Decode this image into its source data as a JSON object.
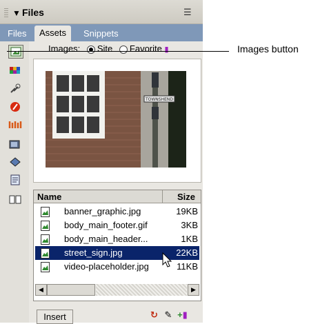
{
  "panel": {
    "title": "Files",
    "tabs": [
      {
        "label": "Files",
        "active": false
      },
      {
        "label": "Assets",
        "active": true
      },
      {
        "label": "Snippets",
        "active": false
      }
    ],
    "images_label": "Images:",
    "radio_site": "Site",
    "radio_favorites": "Favorite",
    "list": {
      "col_name": "Name",
      "col_size": "Size",
      "rows": [
        {
          "name": "banner_graphic.jpg",
          "size": "19KB",
          "selected": false
        },
        {
          "name": "body_main_footer.gif",
          "size": "3KB",
          "selected": false
        },
        {
          "name": "body_main_header...",
          "size": "1KB",
          "selected": false
        },
        {
          "name": "street_sign.jpg",
          "size": "22KB",
          "selected": true
        },
        {
          "name": "video-placeholder.jpg",
          "size": "11KB",
          "selected": false
        }
      ]
    },
    "insert_label": "Insert",
    "preview_sign_text": "TOWNSHEND"
  },
  "callout": {
    "label": "Images button"
  },
  "colors": {
    "selection": "#0a246a",
    "tabbar": "#7f98b8",
    "panel_bg": "#e9e7e2"
  }
}
